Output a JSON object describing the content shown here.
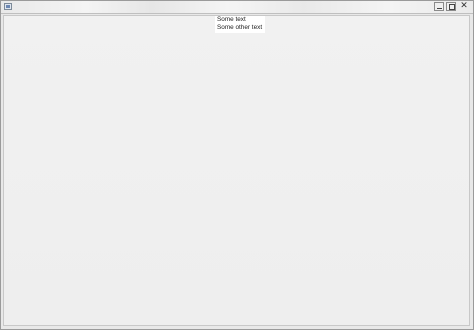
{
  "window": {
    "title": "",
    "app_icon": "java-app-icon",
    "controls": {
      "minimize_icon": "minimize-icon",
      "maximize_icon": "maximize-icon",
      "close_icon": "close-icon",
      "close_glyph": "✕"
    }
  },
  "content": {
    "lines": [
      "Some text",
      "Some other text"
    ]
  }
}
